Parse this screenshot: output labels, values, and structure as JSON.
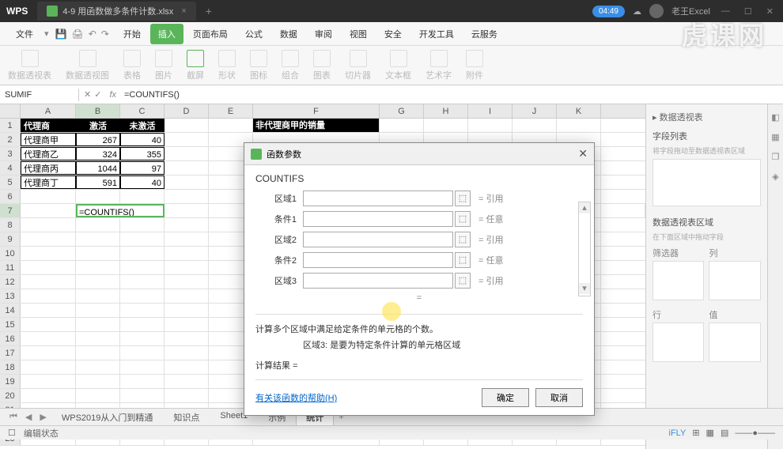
{
  "titlebar": {
    "app": "WPS",
    "filename": "4-9 用函数做多条件计数.xlsx",
    "timer": "04:49",
    "username": "老王Excel"
  },
  "menubar": {
    "file": "文件",
    "tabs": [
      "开始",
      "插入",
      "页面布局",
      "公式",
      "数据",
      "审阅",
      "视图",
      "安全",
      "开发工具",
      "云服务"
    ],
    "active": 1
  },
  "ribbon": {
    "labels": [
      "数据透视表",
      "数据透视图",
      "表格",
      "图片",
      "截屏",
      "形状",
      "图标",
      "组合",
      "图表",
      "切片器",
      "文本框",
      "艺术字",
      "附件"
    ]
  },
  "namebox": "SUMIF",
  "formula": "=COUNTIFS()",
  "columns": [
    "A",
    "B",
    "C",
    "D",
    "E",
    "F",
    "G",
    "H",
    "I",
    "J",
    "K"
  ],
  "table": {
    "headers": [
      "代理商",
      "激活",
      "未激活"
    ],
    "rows": [
      [
        "代理商甲",
        "267",
        "40"
      ],
      [
        "代理商乙",
        "324",
        "355"
      ],
      [
        "代理商丙",
        "1044",
        "97"
      ],
      [
        "代理商丁",
        "591",
        "40"
      ]
    ]
  },
  "title2": "非代理商甲的销量",
  "active_cell": "=COUNTIFS()",
  "dialog": {
    "title": "函数参数",
    "fn": "COUNTIFS",
    "params": [
      {
        "label": "区域1",
        "hint": "= 引用"
      },
      {
        "label": "条件1",
        "hint": "= 任意"
      },
      {
        "label": "区域2",
        "hint": "= 引用"
      },
      {
        "label": "条件2",
        "hint": "= 任意"
      },
      {
        "label": "区域3",
        "hint": "= 引用"
      }
    ],
    "eq": "=",
    "desc": "计算多个区域中满足给定条件的单元格的个数。",
    "param_desc": "区域3:  是要为特定条件计算的单元格区域",
    "result": "计算结果 =",
    "help": "有关该函数的帮助(H)",
    "ok": "确定",
    "cancel": "取消"
  },
  "side": {
    "top": "数据透视表",
    "fields": "字段列表",
    "fields_hint": "将字段拖动至数据透视表区域",
    "area": "数据透视表区域",
    "area_hint": "在下面区域中拖动字段",
    "filters": "筛选器",
    "cols": "列",
    "rows_l": "行",
    "vals": "值"
  },
  "sheets": {
    "tabs": [
      "WPS2019从入门到精通",
      "知识点",
      "Sheet1",
      "示例",
      "统计"
    ],
    "active": 4,
    "add": "+"
  },
  "status": {
    "left": "编辑状态"
  },
  "watermark": "虎课网"
}
